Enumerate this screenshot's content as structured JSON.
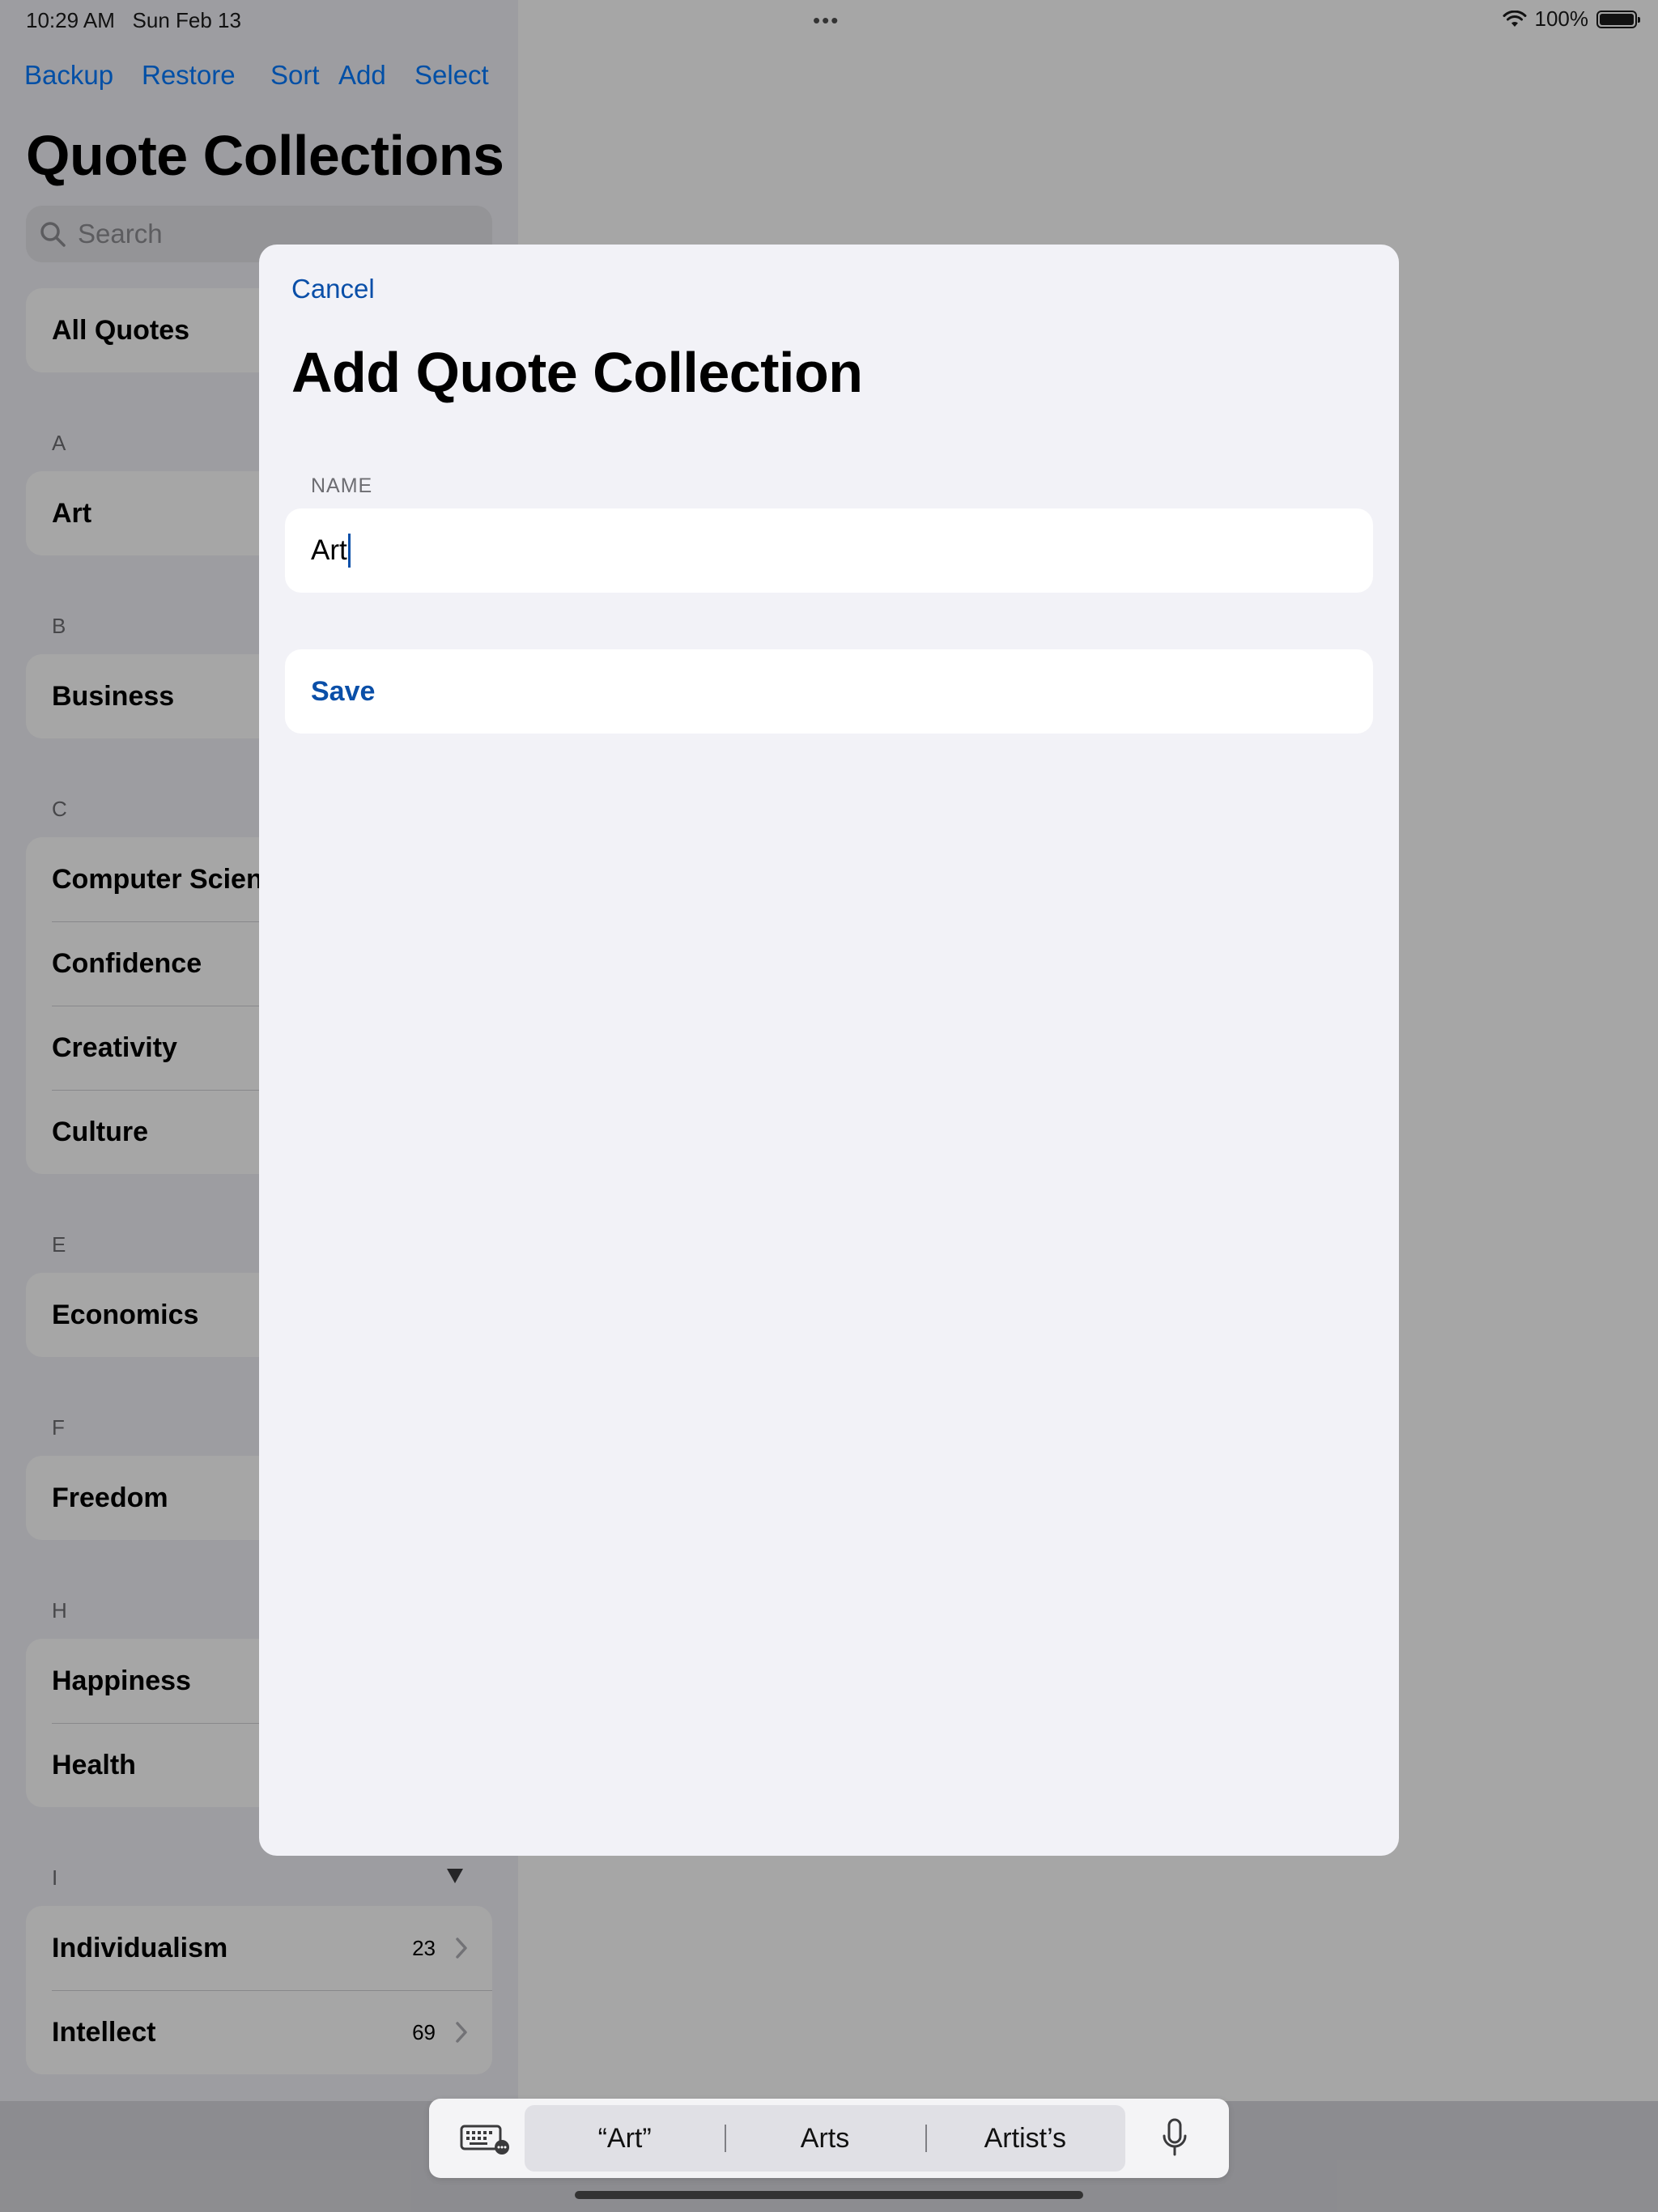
{
  "status_bar": {
    "time": "10:29 AM",
    "date": "Sun Feb 13",
    "multitask_dots": "•••",
    "battery_percent": "100%",
    "icons": [
      "wifi-icon",
      "battery-icon"
    ]
  },
  "sidebar": {
    "toolbar": {
      "backup": "Backup",
      "restore": "Restore",
      "sort": "Sort",
      "add": "Add",
      "select": "Select"
    },
    "title": "Quote Collections",
    "search_placeholder": "Search",
    "all_quotes": "All Quotes",
    "sections": [
      {
        "header": "A",
        "items": [
          {
            "label": "Art"
          }
        ]
      },
      {
        "header": "B",
        "items": [
          {
            "label": "Business"
          }
        ]
      },
      {
        "header": "C",
        "items": [
          {
            "label": "Computer Science"
          },
          {
            "label": "Confidence"
          },
          {
            "label": "Creativity"
          },
          {
            "label": "Culture"
          }
        ]
      },
      {
        "header": "E",
        "items": [
          {
            "label": "Economics"
          }
        ]
      },
      {
        "header": "F",
        "items": [
          {
            "label": "Freedom"
          }
        ]
      },
      {
        "header": "H",
        "items": [
          {
            "label": "Happiness"
          },
          {
            "label": "Health"
          }
        ]
      },
      {
        "header": "I",
        "items": [
          {
            "label": "Individualism",
            "count": "23"
          },
          {
            "label": "Intellect",
            "count": "69"
          }
        ]
      }
    ]
  },
  "modal": {
    "cancel": "Cancel",
    "title": "Add Quote Collection",
    "name_label": "NAME",
    "name_value": "Art",
    "save": "Save"
  },
  "keyboard_bar": {
    "predictions": [
      "“Art”",
      "Arts",
      "Artist’s"
    ],
    "icons": [
      "keyboard-icon",
      "microphone-icon"
    ]
  },
  "colors": {
    "accent": "#0a4fa8",
    "sheet_background": "#f2f2f7",
    "dim_overlay": "rgba(0,0,0,0.35)"
  }
}
